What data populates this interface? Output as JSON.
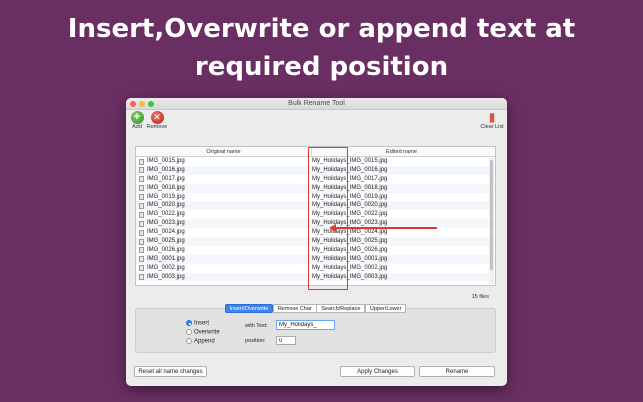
{
  "headline": {
    "line1": "Insert,Overwrite or append text at",
    "line2": "required position"
  },
  "window": {
    "title": "Bulk Rename Tool"
  },
  "toolbar": {
    "add_label": "Add",
    "remove_label": "Remove",
    "clear_label": "Clear List"
  },
  "table": {
    "headers": [
      "Original name",
      "Edited name"
    ],
    "rows": [
      {
        "original": "IMG_0015.jpg",
        "edited": "My_Holidays_IMG_0015.jpg"
      },
      {
        "original": "IMG_0016.jpg",
        "edited": "My_Holidays_IMG_0016.jpg"
      },
      {
        "original": "IMG_0017.jpg",
        "edited": "My_Holidays_IMG_0017.jpg"
      },
      {
        "original": "IMG_0018.jpg",
        "edited": "My_Holidays_IMG_0018.jpg"
      },
      {
        "original": "IMG_0019.jpg",
        "edited": "My_Holidays_IMG_0019.jpg"
      },
      {
        "original": "IMG_0020.jpg",
        "edited": "My_Holidays_IMG_0020.jpg"
      },
      {
        "original": "IMG_0022.jpg",
        "edited": "My_Holidays_IMG_0022.jpg"
      },
      {
        "original": "IMG_0023.jpg",
        "edited": "My_Holidays_IMG_0023.jpg"
      },
      {
        "original": "IMG_0024.jpg",
        "edited": "My_Holidays_IMG_0024.jpg"
      },
      {
        "original": "IMG_0025.jpg",
        "edited": "My_Holidays_IMG_0025.jpg"
      },
      {
        "original": "IMG_0026.jpg",
        "edited": "My_Holidays_IMG_0026.jpg"
      },
      {
        "original": "IMG_0001.jpg",
        "edited": "My_Holidays_IMG_0001.jpg"
      },
      {
        "original": "IMG_0002.jpg",
        "edited": "My_Holidays_IMG_0002.jpg"
      },
      {
        "original": "IMG_0003.jpg",
        "edited": "My_Holidays_IMG_0003.jpg"
      }
    ],
    "file_count": "15 files"
  },
  "tabs": [
    {
      "label": "Insert/Overwrite",
      "active": true
    },
    {
      "label": "Remove Char",
      "active": false
    },
    {
      "label": "Search/Replace",
      "active": false
    },
    {
      "label": "Upper/Lower",
      "active": false
    }
  ],
  "options": {
    "insert_label": "Insert",
    "overwrite_label": "Overwrite",
    "append_label": "Append",
    "selected": "Insert",
    "with_text_label": "with Text:",
    "with_text_value": "My_Holidays_",
    "position_label": "position:",
    "position_value": "0"
  },
  "buttons": {
    "reset": "Reset all name changes",
    "apply": "Apply Changes",
    "rename": "Rename"
  },
  "colors": {
    "background": "#6a2f62",
    "accent_red": "#e0392b",
    "active_tab": "#3b83f0"
  }
}
